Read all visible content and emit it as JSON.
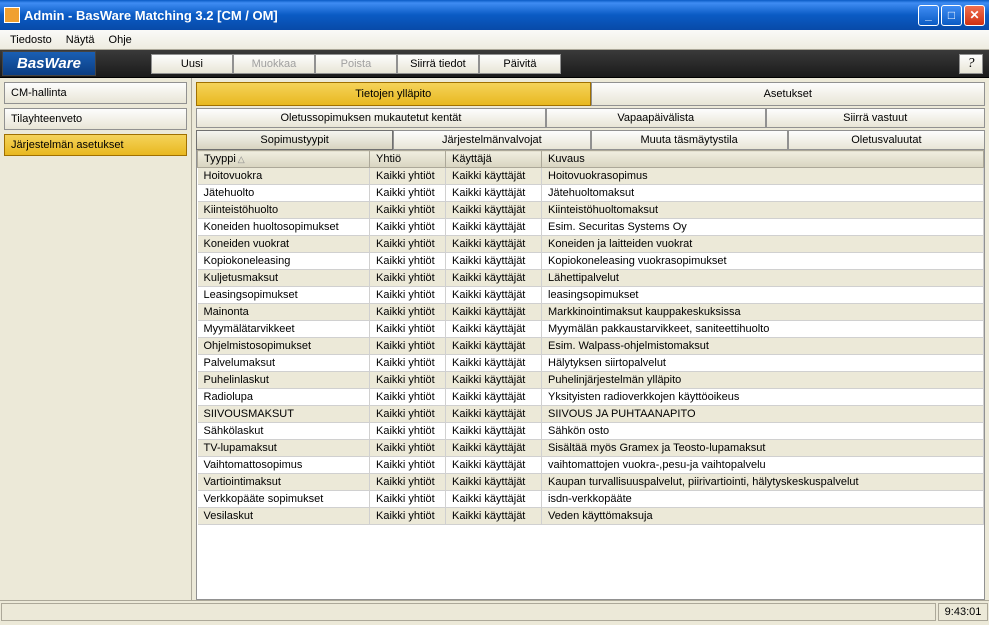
{
  "window": {
    "title": "Admin - BasWare Matching 3.2 [CM / OM]"
  },
  "menu": {
    "file": "Tiedosto",
    "view": "Näytä",
    "help": "Ohje"
  },
  "logo": "BasWare",
  "toolbar": {
    "new": "Uusi",
    "edit": "Muokkaa",
    "delete": "Poista",
    "move": "Siirrä tiedot",
    "refresh": "Päivitä"
  },
  "sidebar": {
    "cm": "CM-hallinta",
    "summary": "Tilayhteenveto",
    "settings": "Järjestelmän asetukset"
  },
  "topTabs": {
    "data": "Tietojen ylläpito",
    "settings": "Asetukset"
  },
  "subTabs1": {
    "custom": "Oletussopimuksen mukautetut kentät",
    "holidays": "Vapaapäivälista",
    "transfer": "Siirrä vastuut"
  },
  "subTabs2": {
    "types": "Sopimustyypit",
    "admins": "Järjestelmänvalvojat",
    "reconcile": "Muuta täsmäytystila",
    "currencies": "Oletusvaluutat"
  },
  "columns": {
    "type": "Tyyppi",
    "company": "Yhtiö",
    "user": "Käyttäjä",
    "desc": "Kuvaus"
  },
  "rows": [
    {
      "type": "Hoitovuokra",
      "company": "Kaikki yhtiöt",
      "user": "Kaikki käyttäjät",
      "desc": "Hoitovuokrasopimus"
    },
    {
      "type": "Jätehuolto",
      "company": "Kaikki yhtiöt",
      "user": "Kaikki käyttäjät",
      "desc": "Jätehuoltomaksut"
    },
    {
      "type": "Kiinteistöhuolto",
      "company": "Kaikki yhtiöt",
      "user": "Kaikki käyttäjät",
      "desc": "Kiinteistöhuoltomaksut"
    },
    {
      "type": "Koneiden huoltosopimukset",
      "company": "Kaikki yhtiöt",
      "user": "Kaikki käyttäjät",
      "desc": "Esim. Securitas Systems Oy"
    },
    {
      "type": "Koneiden vuokrat",
      "company": "Kaikki yhtiöt",
      "user": "Kaikki käyttäjät",
      "desc": "Koneiden ja laitteiden vuokrat"
    },
    {
      "type": "Kopiokoneleasing",
      "company": "Kaikki yhtiöt",
      "user": "Kaikki käyttäjät",
      "desc": "Kopiokoneleasing vuokrasopimukset"
    },
    {
      "type": "Kuljetusmaksut",
      "company": "Kaikki yhtiöt",
      "user": "Kaikki käyttäjät",
      "desc": "Lähettipalvelut"
    },
    {
      "type": "Leasingsopimukset",
      "company": "Kaikki yhtiöt",
      "user": "Kaikki käyttäjät",
      "desc": "leasingsopimukset"
    },
    {
      "type": "Mainonta",
      "company": "Kaikki yhtiöt",
      "user": "Kaikki käyttäjät",
      "desc": "Markkinointimaksut kauppakeskuksissa"
    },
    {
      "type": "Myymälätarvikkeet",
      "company": "Kaikki yhtiöt",
      "user": "Kaikki käyttäjät",
      "desc": "Myymälän pakkaustarvikkeet, saniteettihuolto"
    },
    {
      "type": "Ohjelmistosopimukset",
      "company": "Kaikki yhtiöt",
      "user": "Kaikki käyttäjät",
      "desc": "Esim. Walpass-ohjelmistomaksut"
    },
    {
      "type": "Palvelumaksut",
      "company": "Kaikki yhtiöt",
      "user": "Kaikki käyttäjät",
      "desc": "Hälytyksen siirtopalvelut"
    },
    {
      "type": "Puhelinlaskut",
      "company": "Kaikki yhtiöt",
      "user": "Kaikki käyttäjät",
      "desc": "Puhelinjärjestelmän ylläpito"
    },
    {
      "type": "Radiolupa",
      "company": "Kaikki yhtiöt",
      "user": "Kaikki käyttäjät",
      "desc": "Yksityisten radioverkkojen käyttöoikeus"
    },
    {
      "type": "SIIVOUSMAKSUT",
      "company": "Kaikki yhtiöt",
      "user": "Kaikki käyttäjät",
      "desc": "SIIVOUS JA PUHTAANAPITO"
    },
    {
      "type": "Sähkölaskut",
      "company": "Kaikki yhtiöt",
      "user": "Kaikki käyttäjät",
      "desc": "Sähkön osto"
    },
    {
      "type": "TV-lupamaksut",
      "company": "Kaikki yhtiöt",
      "user": "Kaikki käyttäjät",
      "desc": "Sisältää myös Gramex ja Teosto-lupamaksut"
    },
    {
      "type": "Vaihtomattosopimus",
      "company": "Kaikki yhtiöt",
      "user": "Kaikki käyttäjät",
      "desc": "vaihtomattojen vuokra-,pesu-ja vaihtopalvelu"
    },
    {
      "type": "Vartiointimaksut",
      "company": "Kaikki yhtiöt",
      "user": "Kaikki käyttäjät",
      "desc": "Kaupan turvallisuuspalvelut, piirivartiointi, hälytyskeskuspalvelut"
    },
    {
      "type": "Verkkopääte sopimukset",
      "company": "Kaikki yhtiöt",
      "user": "Kaikki käyttäjät",
      "desc": "isdn-verkkopääte"
    },
    {
      "type": "Vesilaskut",
      "company": "Kaikki yhtiöt",
      "user": "Kaikki käyttäjät",
      "desc": "Veden käyttömaksuja"
    }
  ],
  "status": {
    "time": "9:43:01"
  }
}
